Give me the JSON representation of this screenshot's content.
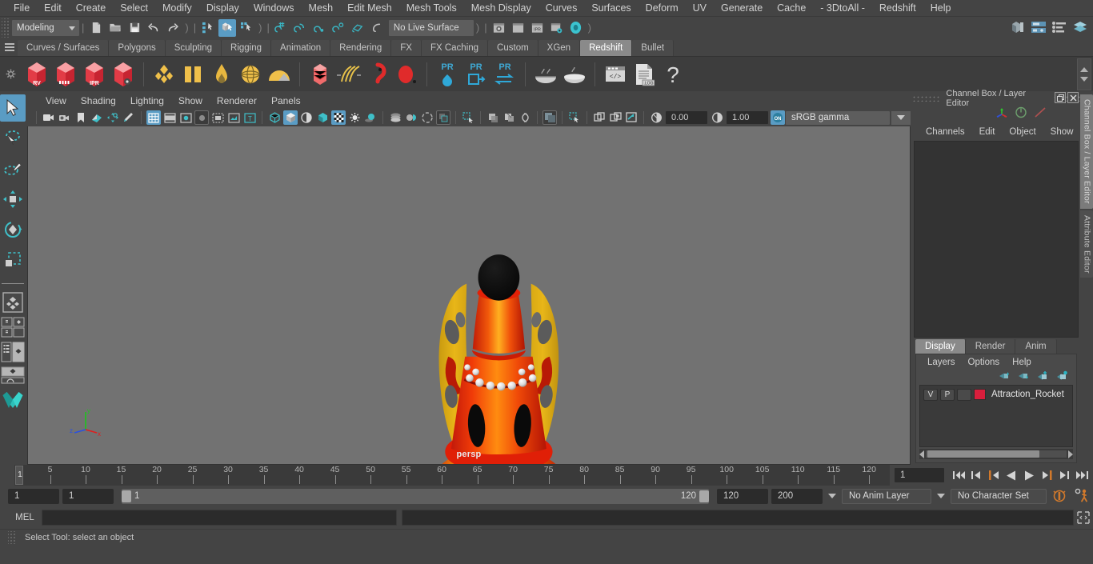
{
  "menubar": {
    "items": [
      "File",
      "Edit",
      "Create",
      "Select",
      "Modify",
      "Display",
      "Windows",
      "Mesh",
      "Edit Mesh",
      "Mesh Tools",
      "Mesh Display",
      "Curves",
      "Surfaces",
      "Deform",
      "UV",
      "Generate",
      "Cache",
      "- 3DtoAll -",
      "Redshift",
      "Help"
    ]
  },
  "statusline": {
    "mode": "Modeling",
    "live_surface": "No Live Surface",
    "icons": [
      "new-scene-icon",
      "open-scene-icon",
      "save-scene-icon",
      "undo-icon",
      "redo-icon",
      "select-by-hierarchy-icon",
      "select-by-object-icon",
      "select-by-component-icon",
      "snap-to-grid-icon",
      "snap-to-curve-icon",
      "snap-to-point-icon",
      "snap-to-projected-center-icon",
      "snap-to-view-plane-icon",
      "make-live-icon",
      "render-current-frame-icon",
      "render-view-icon",
      "ipr-render-icon",
      "render-settings-icon",
      "hypershade-icon"
    ],
    "right_icons": [
      "show-hide-modeling-toolkit-icon",
      "show-hide-attribute-editor-icon",
      "show-hide-tool-settings-icon",
      "show-hide-channel-box-icon"
    ]
  },
  "shelf": {
    "tabs": [
      "Curves / Surfaces",
      "Polygons",
      "Sculpting",
      "Rigging",
      "Animation",
      "Rendering",
      "FX",
      "FX Caching",
      "Custom",
      "XGen",
      "Redshift",
      "Bullet"
    ],
    "active_tab": "Redshift",
    "button_names": [
      "redshift-render-icon",
      "redshift-rv-icon",
      "redshift-render-sequence-icon",
      "redshift-ipr-icon",
      "redshift-settings-icon",
      "redshift-proxy-icon",
      "redshift-matte-icon",
      "redshift-bokeh-icon",
      "redshift-dome-light-icon",
      "redshift-environment-icon",
      "redshift-volume-icon",
      "redshift-hair-icon",
      "redshift-sprite-icon",
      "redshift-point-cloud-icon",
      "redshift-pr-light-icon",
      "redshift-pr-export-icon",
      "redshift-pr-convert-icon",
      "redshift-bake-icon",
      "redshift-bake-set-icon",
      "redshift-script-icon",
      "redshift-log-icon",
      "redshift-help-icon"
    ]
  },
  "toolbox": {
    "tools": [
      "select-tool",
      "lasso-select-tool",
      "paint-select-tool",
      "move-tool",
      "rotate-tool",
      "scale-tool"
    ],
    "active_tool": "select-tool",
    "layouts": [
      "single-perspective-layout",
      "four-view-layout",
      "outliner-persp-layout",
      "hypergraph-persp-layout",
      "maya-logo-icon"
    ]
  },
  "viewport": {
    "menus": [
      "View",
      "Shading",
      "Lighting",
      "Show",
      "Renderer",
      "Panels"
    ],
    "camera_label": "persp",
    "exposure": "0.00",
    "gamma_value": "1.00",
    "color_management": "sRGB gamma",
    "toolbar_icons": [
      "select-camera-icon",
      "camera-attributes-icon",
      "bookmarks-icon",
      "image-plane-icon",
      "two-d-pan-zoom-icon",
      "grease-pencil-icon",
      "grid-toggle-icon",
      "film-gate-icon",
      "resolution-gate-icon",
      "gate-mask-icon",
      "film-origin-icon",
      "safe-action-icon",
      "hud-text-icon",
      "wireframe-icon",
      "smooth-shade-icon",
      "shaded-wireframe-icon",
      "use-default-material-icon",
      "textured-icon",
      "use-all-lights-icon",
      "shadows-icon",
      "screen-space-ao-icon",
      "motion-blur-icon",
      "multisample-icon",
      "depth-of-field-icon",
      "isolate-select-icon",
      "xray-icon",
      "xray-joints-icon",
      "xray-active-components-icon",
      "exposure-icon",
      "gamma-icon",
      "color-management-toggle-icon"
    ],
    "axis_labels": {
      "x": "x",
      "y": "y",
      "z": "z"
    }
  },
  "right_panel": {
    "title": "Channel Box / Layer Editor",
    "menus": [
      "Channels",
      "Edit",
      "Object",
      "Show"
    ],
    "header_icons": [
      "manipulator-icon",
      "attribute-dial-icon",
      "graph-line-icon"
    ],
    "window_buttons": [
      "restore-icon",
      "close-icon"
    ],
    "side_tabs": [
      {
        "label": "Channel Box / Layer Editor",
        "active": true
      },
      {
        "label": "Attribute Editor",
        "active": false
      }
    ],
    "layer_tabs": [
      "Display",
      "Render",
      "Anim"
    ],
    "active_layer_tab": "Display",
    "layer_menus": [
      "Layers",
      "Options",
      "Help"
    ],
    "layer_tool_icons": [
      "move-layer-up-icon",
      "move-layer-down-icon",
      "create-new-layer-icon",
      "create-layer-from-selected-icon"
    ],
    "layers": [
      {
        "visibility": "V",
        "playback": "P",
        "type": "",
        "color": "#d81e3c",
        "name": "Attraction_Rocket"
      }
    ]
  },
  "timeline": {
    "ticks": [
      5,
      10,
      15,
      20,
      25,
      30,
      35,
      40,
      45,
      50,
      55,
      60,
      65,
      70,
      75,
      80,
      85,
      90,
      95,
      100,
      105,
      110,
      115,
      120
    ],
    "current_frame": "1",
    "current_frame_field": "1",
    "playback_icons": [
      "go-to-start-icon",
      "step-back-key-icon",
      "step-back-frame-icon",
      "play-backwards-icon",
      "play-forwards-icon",
      "step-forward-frame-icon",
      "step-forward-key-icon",
      "go-to-end-icon"
    ]
  },
  "range": {
    "anim_start": "1",
    "range_start": "1",
    "slider_min_label": "1",
    "slider_max_label": "120",
    "range_end": "120",
    "anim_end": "200",
    "anim_layer": "No Anim Layer",
    "character_set": "No Character Set",
    "right_icons": [
      "auto-key-icon",
      "animation-preferences-icon"
    ]
  },
  "command_line": {
    "language": "MEL",
    "input_value": "",
    "output_value": "",
    "script-editor-icon": "script-editor-icon"
  },
  "help_line": {
    "text": "Select Tool: select an object"
  },
  "colors": {
    "accent_blue": "#5a9cc4",
    "shelf_active": "#8a8a8a",
    "layer_red": "#d81e3c",
    "viewport_bg": "#727272",
    "orange": "#d2792b"
  }
}
